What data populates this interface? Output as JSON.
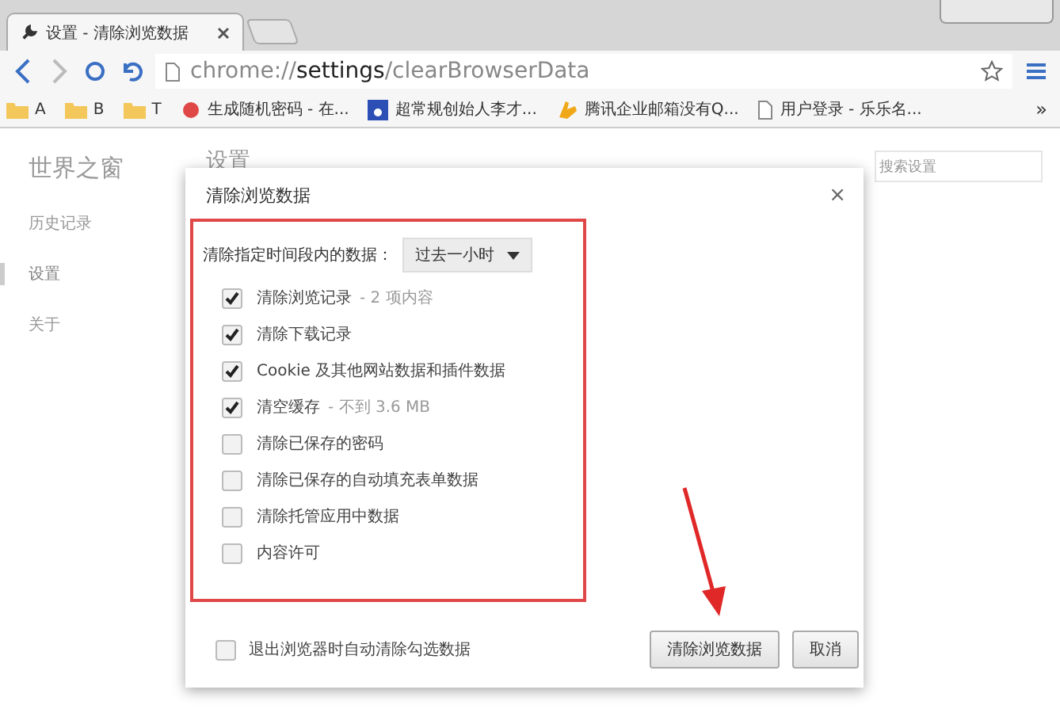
{
  "tab": {
    "title": "设置 - 清除浏览数据"
  },
  "address": {
    "scheme": "chrome://",
    "host": "settings",
    "path": "/clearBrowserData"
  },
  "bookmarks": [
    {
      "kind": "folder",
      "label": "A"
    },
    {
      "kind": "folder",
      "label": "B"
    },
    {
      "kind": "folder",
      "label": "T"
    },
    {
      "kind": "site",
      "label": "生成随机密码 - 在..."
    },
    {
      "kind": "paw",
      "label": "超常规创始人李才..."
    },
    {
      "kind": "hand",
      "label": "腾讯企业邮箱没有Q..."
    },
    {
      "kind": "page",
      "label": "用户登录 - 乐乐名..."
    }
  ],
  "more_bookmarks": "»",
  "sidebar": {
    "title": "世界之窗",
    "items": [
      {
        "label": "历史记录",
        "selected": false
      },
      {
        "label": "设置",
        "selected": true
      },
      {
        "label": "关于",
        "selected": false
      }
    ]
  },
  "page_title": "设置",
  "search": {
    "placeholder": "搜索设置"
  },
  "dialog": {
    "title": "清除浏览数据",
    "close": "×",
    "range_label": "清除指定时间段内的数据：",
    "range_value": "过去一小时",
    "options": [
      {
        "label": "清除浏览记录",
        "note": "- 2 项内容",
        "checked": true
      },
      {
        "label": "清除下载记录",
        "checked": true
      },
      {
        "label": "Cookie 及其他网站数据和插件数据",
        "checked": true
      },
      {
        "label": "清空缓存",
        "note": "- 不到 3.6 MB",
        "checked": true
      },
      {
        "label": "清除已保存的密码",
        "checked": false
      },
      {
        "label": "清除已保存的自动填充表单数据",
        "checked": false
      },
      {
        "label": "清除托管应用中数据",
        "checked": false
      },
      {
        "label": "内容许可",
        "checked": false
      }
    ],
    "exit_option": {
      "label": "退出浏览器时自动清除勾选数据",
      "checked": false
    },
    "buttons": [
      "清除浏览数据",
      "取消"
    ]
  }
}
